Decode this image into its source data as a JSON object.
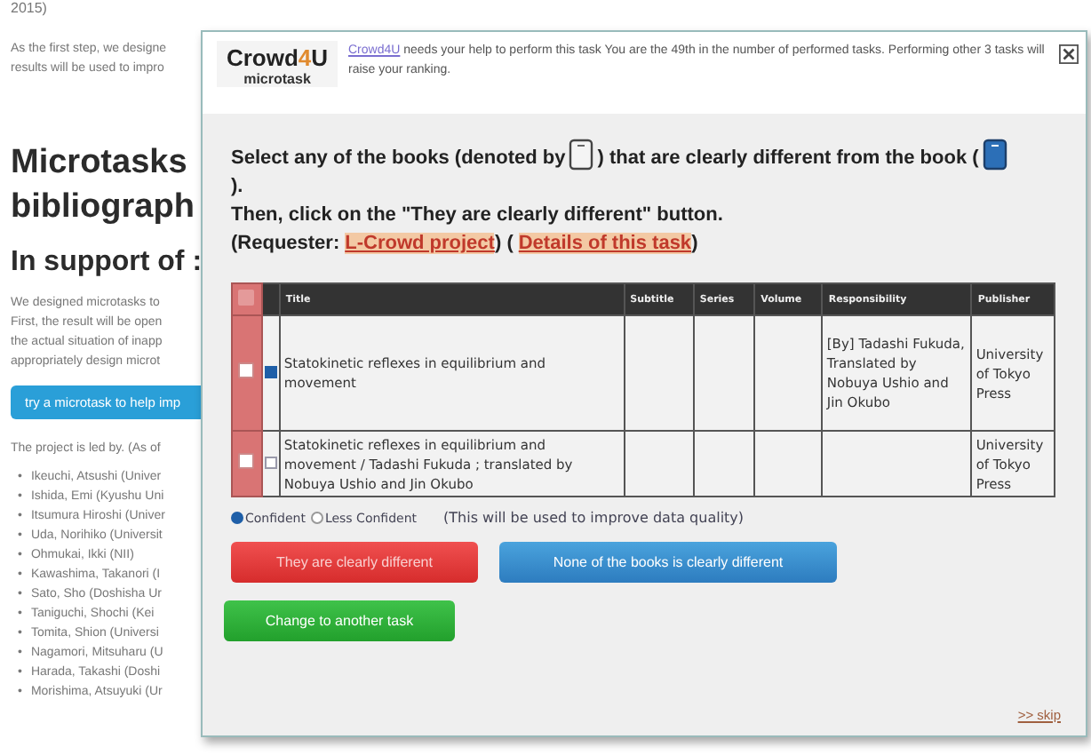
{
  "page": {
    "top_text": "2015)",
    "intro": [
      "As the first step, we designe",
      "results will be used to impro"
    ],
    "heading": [
      "Microtasks",
      "bibliograph"
    ],
    "subheading": "In support of :",
    "paragraph": [
      "We designed microtasks to",
      "First, the result will be open",
      "the actual situation of inapp",
      "appropriately design microt"
    ],
    "try_button": "try a microtask to help imp",
    "led_by": "The project is led by. (As of",
    "bullet": "•",
    "members": [
      "Ikeuchi, Atsushi (Univer",
      "Ishida, Emi (Kyushu Uni",
      "Itsumura Hiroshi (Univer",
      "Uda, Norihiko (Universit",
      "Ohmukai, Ikki (NII)",
      "Kawashima, Takanori (I",
      "Sato, Sho (Doshisha Ur",
      "Taniguchi, Shochi (Kei",
      "Tomita, Shion (Universi",
      "Nagamori, Mitsuharu (U",
      "Harada, Takashi (Doshi",
      "Morishima, Atsuyuki (Ur"
    ]
  },
  "dialog": {
    "logo": [
      "Crowd",
      "4",
      "U"
    ],
    "logo_sub": "microtask",
    "notice_link": "Crowd4U",
    "notice": " needs your help to perform this task You are the 49th in the number of performed tasks. Performing other 3 tasks will raise your ranking.",
    "instruction": [
      {
        "kind": "text",
        "text": "Select any of the books (denoted by"
      },
      {
        "kind": "blank-book"
      },
      {
        "kind": "text",
        "text": ") that are clearly different from the book ("
      },
      {
        "kind": "filled-book"
      },
      {
        "kind": "break"
      },
      {
        "kind": "text",
        "text": ")."
      },
      {
        "kind": "break"
      },
      {
        "kind": "text",
        "text": "Then, click on the \"They are clearly different\" button."
      },
      {
        "kind": "break"
      },
      {
        "kind": "text",
        "text": "(Requester:"
      },
      {
        "kind": "link",
        "text": "L-Crowd project"
      },
      {
        "kind": "text",
        "text": ") ("
      },
      {
        "kind": "link",
        "text": "Details of this task"
      },
      {
        "kind": "text",
        "text": ")"
      }
    ],
    "select_all_checked": false,
    "columns": [
      "Title",
      "Subtitle",
      "Series",
      "Volume",
      "Responsibility",
      "Publisher"
    ],
    "rows": [
      {
        "checked": false,
        "reference": true,
        "cells": [
          "Statokinetic reflexes in equilibrium and movement",
          "",
          "",
          "",
          "[By] Tadashi Fukuda, Translated by Nobuya Ushio and Jin Okubo",
          "University of Tokyo Press"
        ]
      },
      {
        "checked": false,
        "reference": false,
        "cells": [
          "Statokinetic reflexes in equilibrium and movement / Tadashi Fukuda ; translated by Nobuya Ushio and Jin Okubo",
          "",
          "",
          "",
          "",
          "University of Tokyo Press"
        ]
      }
    ],
    "confidence": [
      {
        "label": "Confident",
        "selected": true
      },
      {
        "label": "Less Confident",
        "selected": false
      }
    ],
    "confidence_note": "(This will be used to improve data quality)",
    "buttons": [
      {
        "label": "They are clearly different",
        "kind": "danger"
      },
      {
        "label": "None of the books is clearly different",
        "kind": "primary"
      },
      {
        "label": "Change to another task",
        "kind": "success"
      }
    ],
    "skip": ">> skip"
  }
}
